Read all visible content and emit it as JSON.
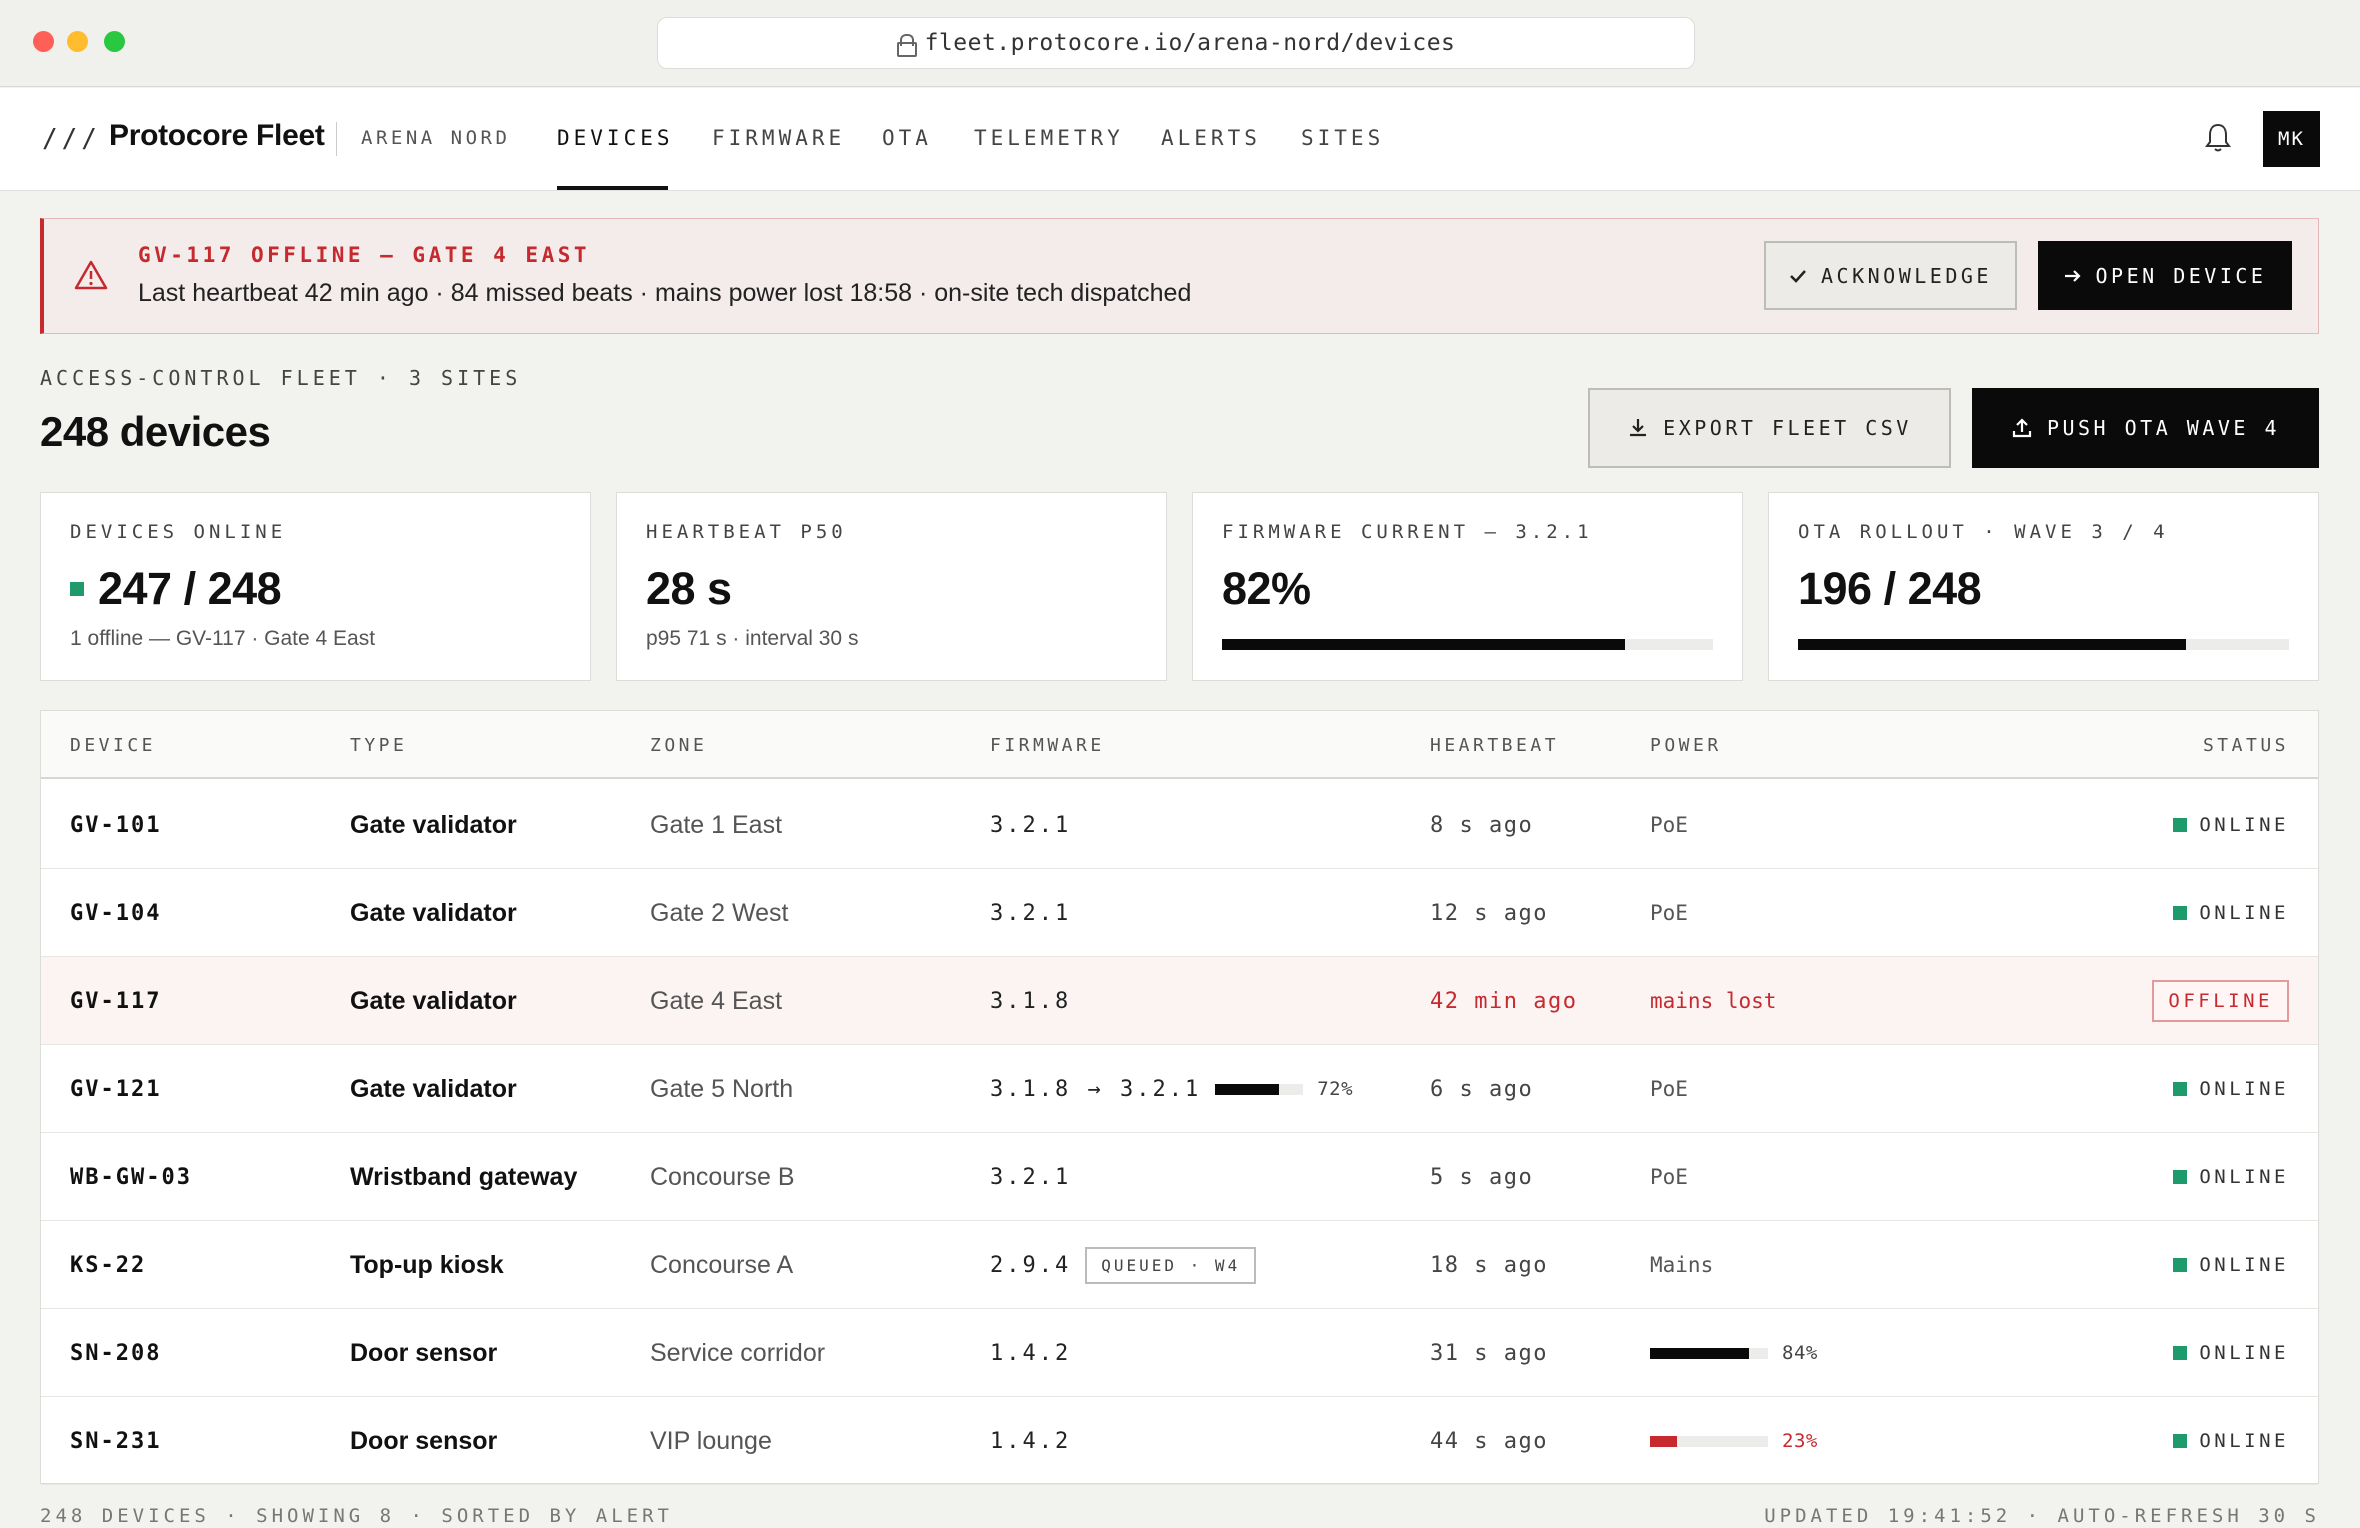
{
  "browser": {
    "url": "fleet.protocore.io/arena-nord/devices"
  },
  "nav": {
    "slashes": "///",
    "brand": "Protocore Fleet",
    "site": "ARENA NORD",
    "tabs": [
      "DEVICES",
      "FIRMWARE",
      "OTA",
      "TELEMETRY",
      "ALERTS",
      "SITES"
    ],
    "active_tab": "DEVICES",
    "avatar": "MK"
  },
  "alert": {
    "title": "GV-117 OFFLINE — GATE 4 EAST",
    "text": "Last heartbeat 42 min ago · 84 missed beats · mains power lost 18:58 · on-site tech dispatched",
    "ack_label": "ACKNOWLEDGE",
    "open_label": "OPEN DEVICE"
  },
  "section": {
    "label": "ACCESS-CONTROL FLEET · 3 SITES",
    "title": "248 devices",
    "export_label": "EXPORT FLEET CSV",
    "push_label": "PUSH OTA WAVE 4"
  },
  "kpis": [
    {
      "label": "DEVICES ONLINE",
      "value": "247 / 248",
      "sub": "1 offline — GV-117 · Gate 4 East"
    },
    {
      "label": "HEARTBEAT P50",
      "value": "28 s",
      "sub": "p95 71 s · interval 30 s"
    },
    {
      "label": "FIRMWARE CURRENT — 3.2.1",
      "value": "82%",
      "progress": 0.82
    },
    {
      "label": "OTA ROLLOUT · WAVE 3 / 4",
      "value": "196 / 248",
      "progress": 0.79
    }
  ],
  "table": {
    "headers": [
      "DEVICE",
      "TYPE",
      "ZONE",
      "FIRMWARE",
      "HEARTBEAT",
      "POWER",
      "STATUS"
    ],
    "rows": [
      {
        "device": "GV-101",
        "type": "Gate validator",
        "zone": "Gate 1 East",
        "firmware": "3.2.1",
        "heartbeat": "8 s ago",
        "power": "PoE",
        "status": "ONLINE"
      },
      {
        "device": "GV-104",
        "type": "Gate validator",
        "zone": "Gate 2 West",
        "firmware": "3.2.1",
        "heartbeat": "12 s ago",
        "power": "PoE",
        "status": "ONLINE"
      },
      {
        "device": "GV-117",
        "type": "Gate validator",
        "zone": "Gate 4 East",
        "firmware": "3.1.8",
        "heartbeat": "42 min ago",
        "power": "mains lost",
        "status": "OFFLINE"
      },
      {
        "device": "GV-121",
        "type": "Gate validator",
        "zone": "Gate 5 North",
        "firmware": "3.1.8 → 3.2.1",
        "fw_progress": 0.72,
        "fw_pct": "72%",
        "heartbeat": "6 s ago",
        "power": "PoE",
        "status": "ONLINE"
      },
      {
        "device": "WB-GW-03",
        "type": "Wristband gateway",
        "zone": "Concourse B",
        "firmware": "3.2.1",
        "heartbeat": "5 s ago",
        "power": "PoE",
        "status": "ONLINE"
      },
      {
        "device": "KS-22",
        "type": "Top-up kiosk",
        "zone": "Concourse A",
        "firmware": "2.9.4",
        "fw_tag": "QUEUED · W4",
        "heartbeat": "18 s ago",
        "power": "Mains",
        "status": "ONLINE"
      },
      {
        "device": "SN-208",
        "type": "Door sensor",
        "zone": "Service corridor",
        "firmware": "1.4.2",
        "heartbeat": "31 s ago",
        "battery": 0.84,
        "battery_pct": "84%",
        "status": "ONLINE"
      },
      {
        "device": "SN-231",
        "type": "Door sensor",
        "zone": "VIP lounge",
        "firmware": "1.4.2",
        "heartbeat": "44 s ago",
        "battery": 0.23,
        "battery_pct": "23%",
        "status": "ONLINE"
      }
    ]
  },
  "footer": {
    "left": "248 DEVICES · SHOWING 8 · SORTED BY ALERT",
    "right": "UPDATED 19:41:52 · AUTO-REFRESH 30 S"
  },
  "colors": {
    "accent_red": "#c62a2f",
    "online_green": "#1f9a6a",
    "dark": "#0a0a0a"
  }
}
